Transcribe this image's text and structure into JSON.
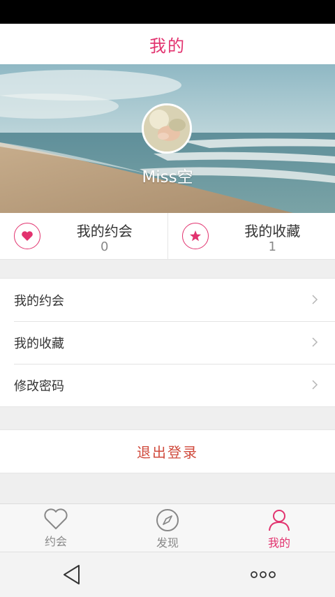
{
  "header": {
    "title": "我的"
  },
  "profile": {
    "username": "Miss空"
  },
  "stats": [
    {
      "label": "我的约会",
      "count": "0",
      "icon": "heart-icon"
    },
    {
      "label": "我的收藏",
      "count": "1",
      "icon": "star-icon"
    }
  ],
  "menu": [
    {
      "label": "我的约会"
    },
    {
      "label": "我的收藏"
    },
    {
      "label": "修改密码"
    }
  ],
  "logout": {
    "label": "退出登录"
  },
  "tabs": [
    {
      "label": "约会",
      "icon": "heart-outline-icon",
      "active": false
    },
    {
      "label": "发现",
      "icon": "compass-icon",
      "active": false
    },
    {
      "label": "我的",
      "icon": "person-icon",
      "active": true
    }
  ],
  "colors": {
    "accent": "#e2336f",
    "logout": "#d04a3c"
  }
}
